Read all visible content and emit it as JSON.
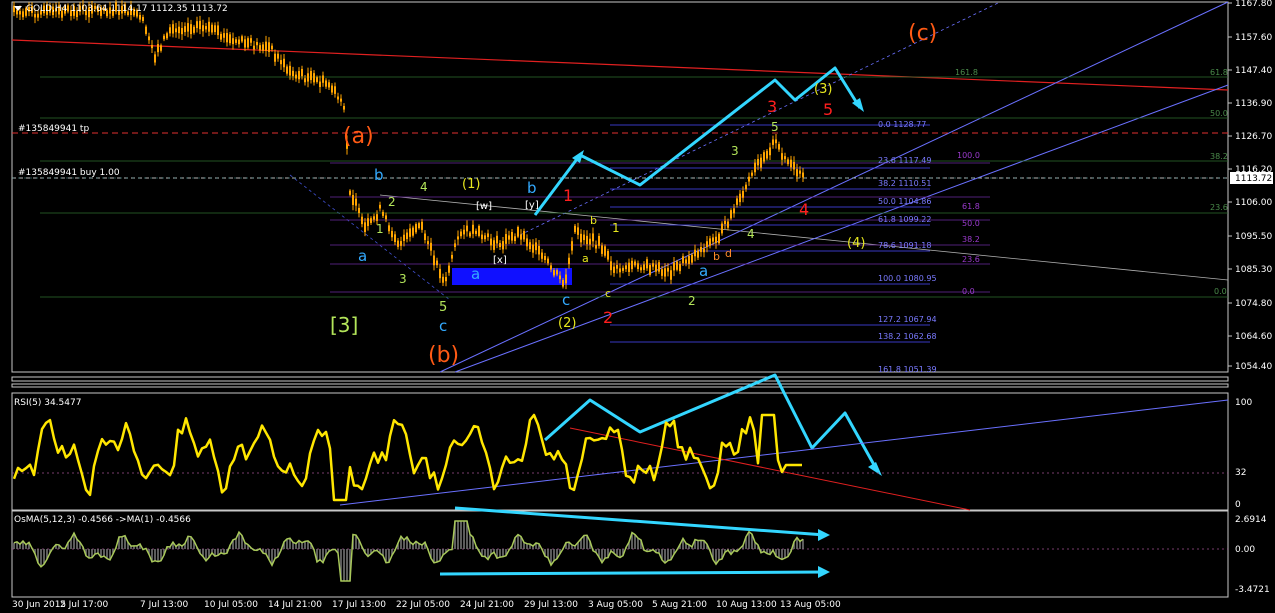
{
  "header": {
    "symbol": "GOLD,H4",
    "ohlc": "1103.64 1114.17 1112.35 1113.72"
  },
  "price_axis": {
    "ticks": [
      "1167.80",
      "1157.60",
      "1147.40",
      "1136.90",
      "1126.70",
      "1116.20",
      "1106.00",
      "1095.50",
      "1085.30",
      "1074.80",
      "1064.60",
      "1054.40"
    ],
    "current": "1113.72",
    "current_color": "#ffffff"
  },
  "time_axis": {
    "ticks": [
      "30 Jun 2015",
      "2 Jul 17:00",
      "7 Jul 13:00",
      "10 Jul 05:00",
      "14 Jul 21:00",
      "17 Jul 13:00",
      "22 Jul 05:00",
      "24 Jul 21:00",
      "29 Jul 13:00",
      "3 Aug 05:00",
      "5 Aug 21:00",
      "10 Aug 13:00",
      "13 Aug 05:00"
    ]
  },
  "order_lines": {
    "tp_label": "#135849941 tp",
    "buy_label": "#135849941 buy 1.00"
  },
  "fib_right": [
    "0.0 1128.77",
    "23.6 1117.49",
    "38.2 1110.51",
    "50.0 1104.86",
    "61.8 1099.22",
    "78.6 1091.18",
    "100.0 1080.95",
    "127.2 1067.94",
    "138.2 1062.68",
    "161.8 1051.39"
  ],
  "fib_purple": [
    "100.0",
    "61.8",
    "50.0",
    "38.2",
    "23.6",
    "0.0"
  ],
  "fib_edge": [
    "161.8",
    "61.8",
    "50.0",
    "38.2",
    "23.6",
    "0.0"
  ],
  "waves": {
    "a_paren": "(a)",
    "b_paren": "(b)",
    "c_paren": "(c)",
    "three_bracket": "[3]",
    "one_paren": "(1)",
    "two_paren": "(2)",
    "three_paren": "(3)",
    "four_paren": "(4)",
    "w_bracket": "[w]",
    "x_bracket": "[x]",
    "y_bracket": "[y]",
    "a": "a",
    "b": "b",
    "c": "c",
    "n1": "1",
    "n2": "2",
    "n3": "3",
    "n4": "4",
    "n5": "5",
    "d": "d"
  },
  "rsi": {
    "label": "RSI(5) 34.5477",
    "ticks": [
      "100",
      "32",
      "0"
    ]
  },
  "osma": {
    "label": "OsMA(5,12,3) -0.4566 ->MA(1) -0.4566",
    "ticks": [
      "2.6914",
      "0.00",
      "-3.4721"
    ]
  },
  "colors": {
    "candle": "#ffa500",
    "ma_red": "#e02020",
    "channel_blue": "#6a70ff",
    "fib_blue": "#6a6aff",
    "arrow_cyan": "#33d6ff",
    "rsi_yellow": "#ffe600",
    "osma_green": "#a8c85a",
    "box_blue": "#1010ff",
    "grid_green": "#2e6e2e",
    "label_orange": "#ff5a14",
    "label_red": "#ff1e1e",
    "label_yellow": "#e6e61e",
    "label_green": "#b4e65a",
    "label_cyan": "#33aaff"
  }
}
